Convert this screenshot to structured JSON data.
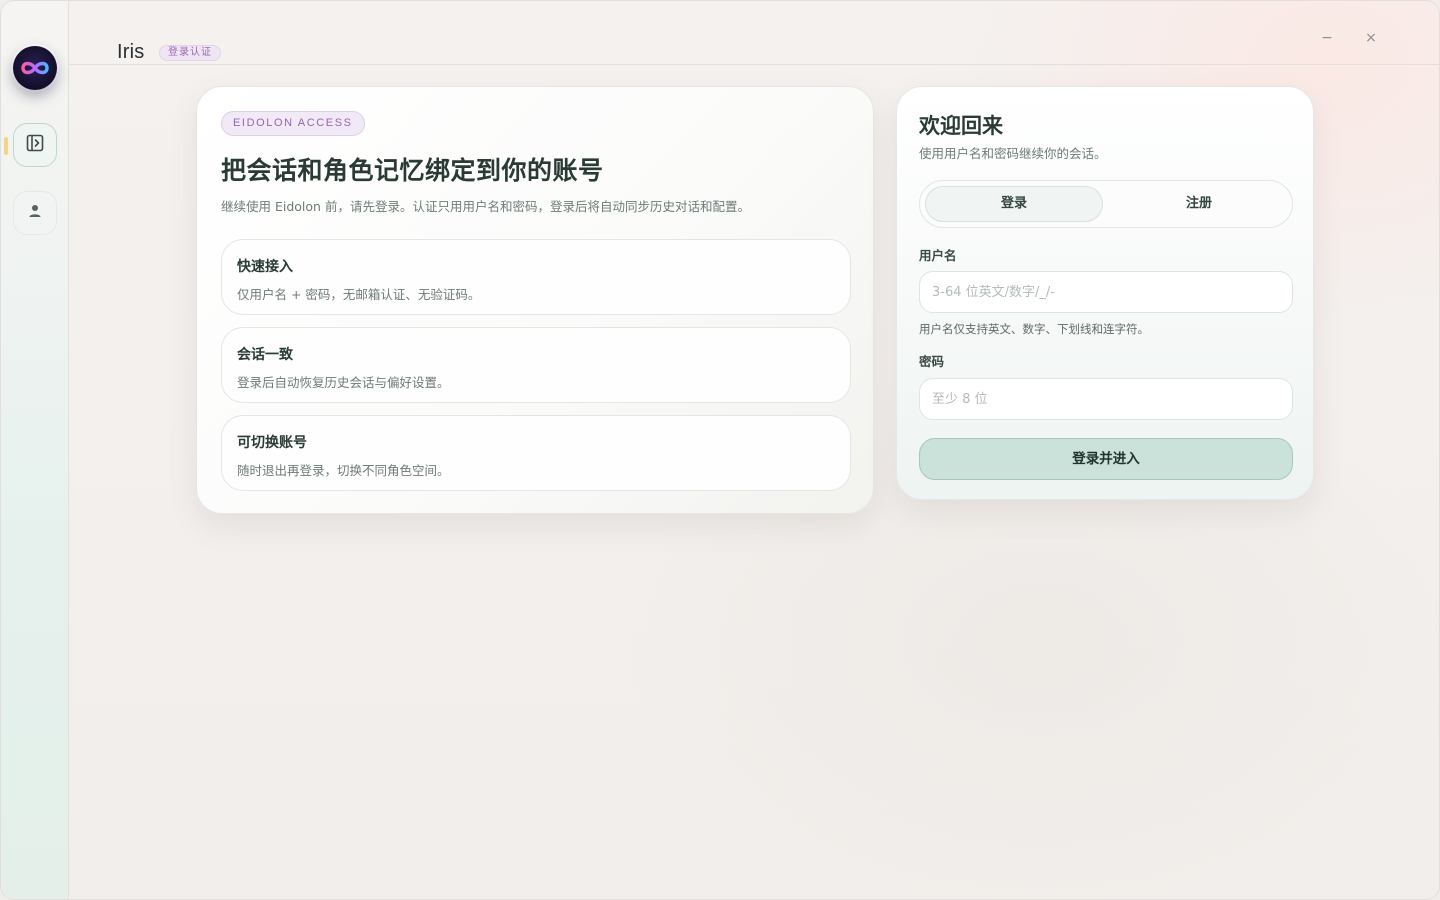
{
  "app": {
    "title": "Iris",
    "badge": "登录认证"
  },
  "sidebar": {
    "logo_icon": "infinity-logo-icon",
    "items": [
      {
        "name": "toggle-panel",
        "icon": "panel-toggle-icon",
        "active": true
      },
      {
        "name": "account",
        "icon": "user-icon",
        "active": false
      }
    ]
  },
  "window_controls": {
    "minimize": "−",
    "close": "×"
  },
  "hero": {
    "eyebrow": "EIDOLON ACCESS",
    "title": "把会话和角色记忆绑定到你的账号",
    "subtitle": "继续使用 Eidolon 前，请先登录。认证只用用户名和密码，登录后将自动同步历史对话和配置。",
    "features": [
      {
        "title": "快速接入",
        "desc": "仅用户名 + 密码，无邮箱认证、无验证码。"
      },
      {
        "title": "会话一致",
        "desc": "登录后自动恢复历史会话与偏好设置。"
      },
      {
        "title": "可切换账号",
        "desc": "随时退出再登录，切换不同角色空间。"
      }
    ]
  },
  "login": {
    "title": "欢迎回来",
    "subtitle": "使用用户名和密码继续你的会话。",
    "tabs": {
      "login": "登录",
      "register": "注册"
    },
    "username": {
      "label": "用户名",
      "value": "",
      "placeholder": "3-64 位英文/数字/_/-",
      "hint": "用户名仅支持英文、数字、下划线和连字符。"
    },
    "password": {
      "label": "密码",
      "value": "",
      "placeholder": "至少 8 位"
    },
    "submit_label": "登录并进入"
  },
  "colors": {
    "accent": "#cae2da",
    "accent_border": "#a3c8bd",
    "eyebrow_text": "#9466ae",
    "eyebrow_bg": "#f1e9f6",
    "heading": "#2a3b36"
  }
}
